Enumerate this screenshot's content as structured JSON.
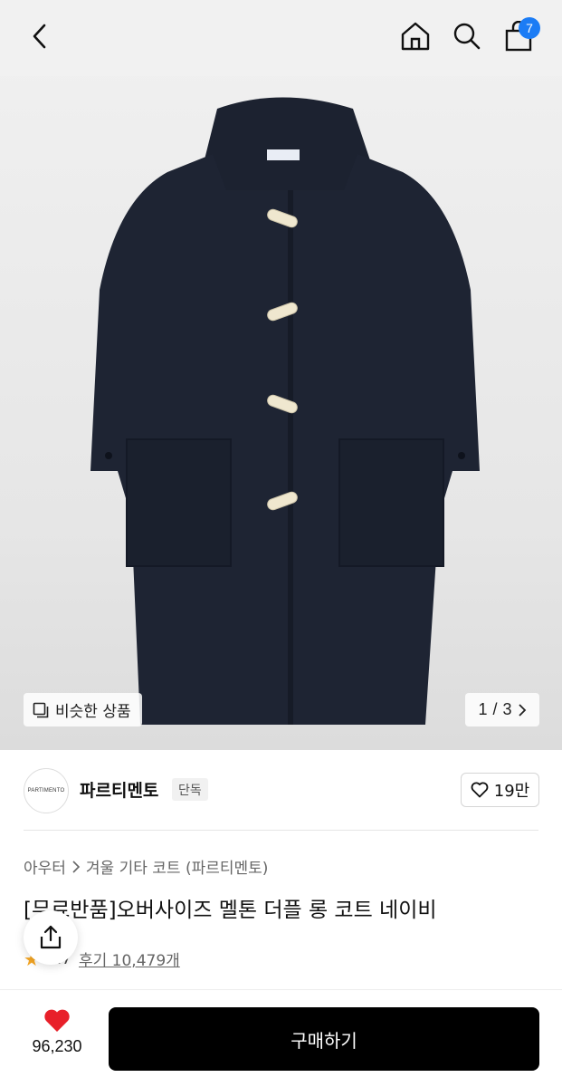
{
  "header": {
    "back_icon": "chevron-left-icon",
    "home_icon": "home-icon",
    "search_icon": "search-icon",
    "cart_icon": "shopping-bag-icon",
    "cart_count": "7",
    "badge_color": "#1b7cf5"
  },
  "hero": {
    "similar_label": "비슷한 상품",
    "pager_current": "1",
    "pager_separator": "/",
    "pager_total": "3"
  },
  "brand": {
    "logo_text": "PARTIMENTO",
    "name": "파르티멘토",
    "badge": "단독",
    "like_count": "19만"
  },
  "product": {
    "breadcrumb": [
      "아우터",
      "겨울 기타 코트 (파르티멘토)"
    ],
    "title": "[무료반품]오버사이즈 멜톤 더플 롱 코트 네이비",
    "rating": "4.7",
    "review_label": "후기 10,479개"
  },
  "bottom": {
    "fav_count": "96,230",
    "buy_label": "구매하기",
    "heart_color": "#e8202a"
  }
}
